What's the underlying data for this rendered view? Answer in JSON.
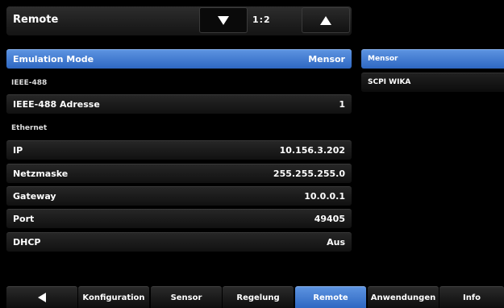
{
  "header": {
    "title": "Remote",
    "page_indicator": "1:2"
  },
  "rows": {
    "emulation": {
      "label": "Emulation Mode",
      "value": "Mensor"
    },
    "ieee_section": "IEEE-488",
    "ieee_address": {
      "label": "IEEE-488 Adresse",
      "value": "1"
    },
    "ethernet_section": "Ethernet",
    "ip": {
      "label": "IP",
      "value": "10.156.3.202"
    },
    "netmask": {
      "label": "Netzmaske",
      "value": "255.255.255.0"
    },
    "gateway": {
      "label": "Gateway",
      "value": "10.0.0.1"
    },
    "port": {
      "label": "Port",
      "value": "49405"
    },
    "dhcp": {
      "label": "DHCP",
      "value": "Aus"
    }
  },
  "options": [
    "Mensor",
    "SCPI WIKA"
  ],
  "tabs": [
    "Konfiguration",
    "Sensor",
    "Regelung",
    "Remote",
    "Anwendungen",
    "Info"
  ],
  "colors": {
    "accent": "#3d7bd6"
  }
}
